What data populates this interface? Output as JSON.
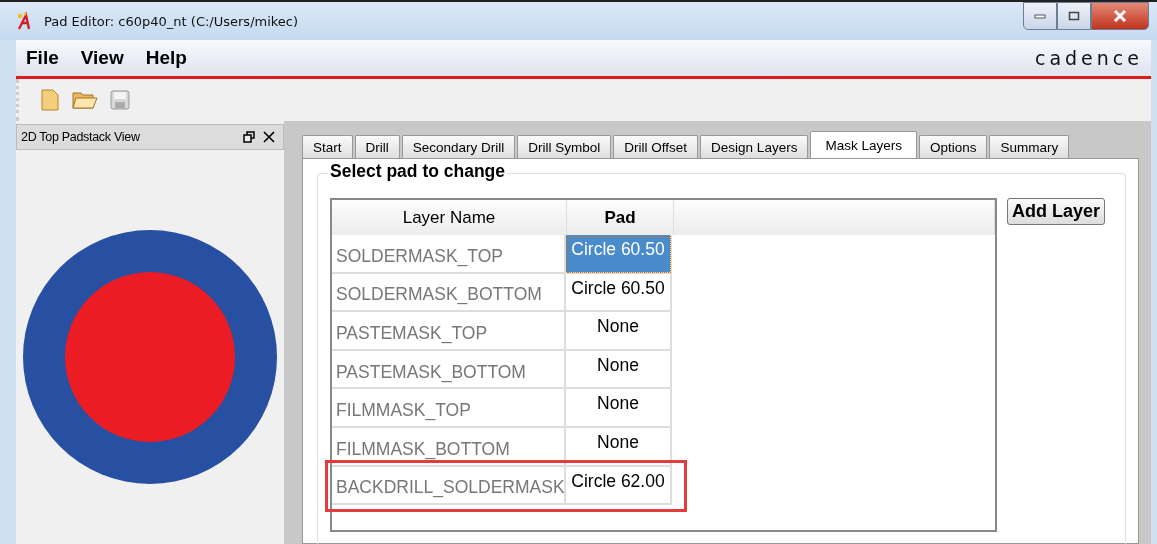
{
  "window": {
    "title": "Pad Editor: c60p40_nt  (C:/Users/mikec)"
  },
  "menu": [
    "File",
    "View",
    "Help"
  ],
  "brand": "cadence",
  "view_panel": {
    "title": "2D Top Padstack View"
  },
  "tabs": [
    {
      "label": "Start",
      "selected": false
    },
    {
      "label": "Drill",
      "selected": false
    },
    {
      "label": "Secondary Drill",
      "selected": false
    },
    {
      "label": "Drill Symbol",
      "selected": false
    },
    {
      "label": "Drill Offset",
      "selected": false
    },
    {
      "label": "Design Layers",
      "selected": false
    },
    {
      "label": "Mask Layers",
      "selected": true
    },
    {
      "label": "Options",
      "selected": false
    },
    {
      "label": "Summary",
      "selected": false
    }
  ],
  "group_title": "Select pad to change",
  "table": {
    "columns": [
      "Layer Name",
      "Pad"
    ],
    "rows": [
      {
        "layer": "SOLDERMASK_TOP",
        "pad": "Circle 60.50",
        "selected": true,
        "highlighted": false
      },
      {
        "layer": "SOLDERMASK_BOTTOM",
        "pad": "Circle 60.50",
        "selected": false,
        "highlighted": false
      },
      {
        "layer": "PASTEMASK_TOP",
        "pad": "None",
        "selected": false,
        "highlighted": false
      },
      {
        "layer": "PASTEMASK_BOTTOM",
        "pad": "None",
        "selected": false,
        "highlighted": false
      },
      {
        "layer": "FILMMASK_TOP",
        "pad": "None",
        "selected": false,
        "highlighted": false
      },
      {
        "layer": "FILMMASK_BOTTOM",
        "pad": "None",
        "selected": false,
        "highlighted": false
      },
      {
        "layer": "BACKDRILL_SOLDERMASK",
        "pad": "Circle 62.00",
        "selected": false,
        "highlighted": true
      }
    ]
  },
  "add_button": "Add Layer"
}
